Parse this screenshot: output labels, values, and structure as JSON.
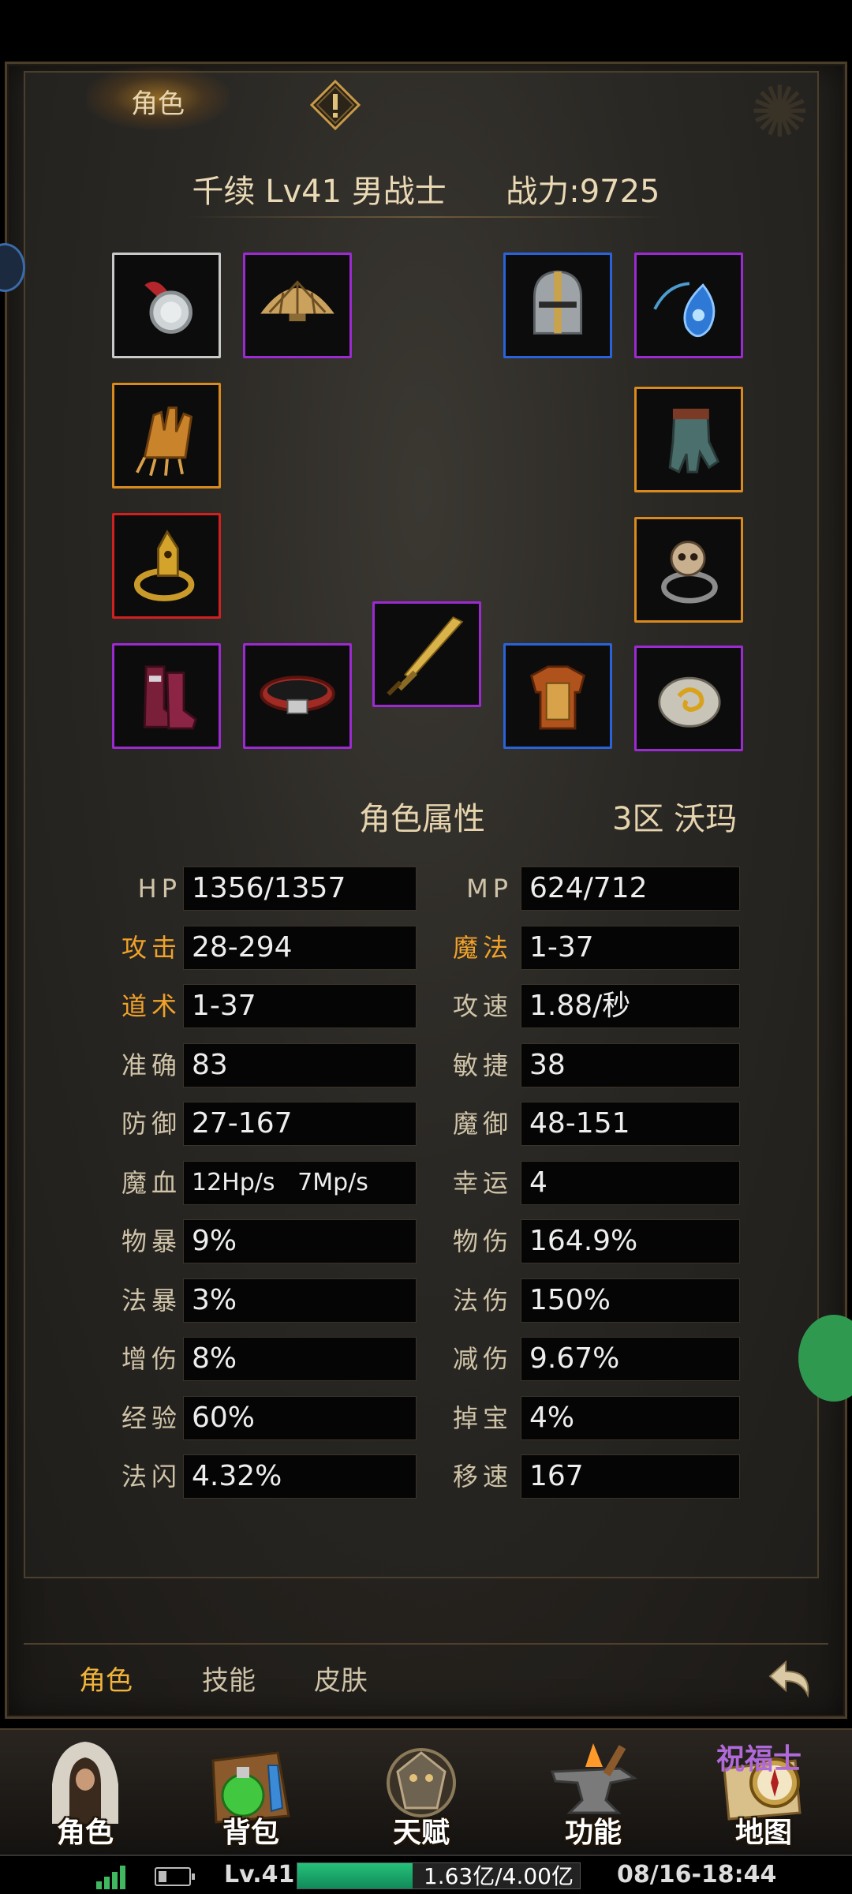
{
  "window": {
    "top_tab": "角色",
    "title": {
      "name": "千续",
      "level": "Lv41",
      "class": "男战士",
      "power": "战力:9725"
    }
  },
  "equipment": [
    {
      "slot": "necklace",
      "quality": "white",
      "icon": "amulet-icon"
    },
    {
      "slot": "shoulder",
      "quality": "purple",
      "icon": "fan-icon"
    },
    {
      "slot": "helmet",
      "quality": "blue",
      "icon": "helmet-icon"
    },
    {
      "slot": "gem",
      "quality": "purple",
      "icon": "gem-pendant-icon"
    },
    {
      "slot": "bracelet-left",
      "quality": "orange",
      "icon": "claw-glove-icon"
    },
    {
      "slot": "bracelet-right",
      "quality": "orange",
      "icon": "glove-icon"
    },
    {
      "slot": "ring-left",
      "quality": "red",
      "icon": "dragon-ring-icon"
    },
    {
      "slot": "ring-right",
      "quality": "orange",
      "icon": "skull-ring-icon"
    },
    {
      "slot": "boots",
      "quality": "purple",
      "icon": "boots-icon"
    },
    {
      "slot": "belt",
      "quality": "purple",
      "icon": "belt-icon"
    },
    {
      "slot": "weapon",
      "quality": "purple",
      "icon": "sword-icon"
    },
    {
      "slot": "armor",
      "quality": "blue",
      "icon": "armor-icon"
    },
    {
      "slot": "charm",
      "quality": "purple",
      "icon": "stone-icon"
    }
  ],
  "attributes": {
    "heading": "角色属性",
    "server": "3区 沃玛",
    "left": [
      {
        "label": "HP",
        "value": "1356/1357",
        "highlight": false
      },
      {
        "label": "攻击",
        "value": "28-294",
        "highlight": true
      },
      {
        "label": "道术",
        "value": "1-37",
        "highlight": true
      },
      {
        "label": "准确",
        "value": "83",
        "highlight": false
      },
      {
        "label": "防御",
        "value": "27-167",
        "highlight": false
      },
      {
        "label": "魔血",
        "value": "12Hp/s   7Mp/s",
        "highlight": false
      },
      {
        "label": "物暴",
        "value": "9%",
        "highlight": false
      },
      {
        "label": "法暴",
        "value": "3%",
        "highlight": false
      },
      {
        "label": "增伤",
        "value": "8%",
        "highlight": false
      },
      {
        "label": "经验",
        "value": "60%",
        "highlight": false
      },
      {
        "label": "法闪",
        "value": "4.32%",
        "highlight": false
      }
    ],
    "right": [
      {
        "label": "MP",
        "value": "624/712",
        "highlight": false
      },
      {
        "label": "魔法",
        "value": "1-37",
        "highlight": true
      },
      {
        "label": "攻速",
        "value": "1.88/秒",
        "highlight": false
      },
      {
        "label": "敏捷",
        "value": "38",
        "highlight": false
      },
      {
        "label": "魔御",
        "value": "48-151",
        "highlight": false
      },
      {
        "label": "幸运",
        "value": "4",
        "highlight": false
      },
      {
        "label": "物伤",
        "value": "164.9%",
        "highlight": false
      },
      {
        "label": "法伤",
        "value": "150%",
        "highlight": false
      },
      {
        "label": "减伤",
        "value": "9.67%",
        "highlight": false
      },
      {
        "label": "掉宝",
        "value": "4%",
        "highlight": false
      },
      {
        "label": "移速",
        "value": "167",
        "highlight": false
      }
    ]
  },
  "tabs": [
    {
      "label": "角色",
      "active": true
    },
    {
      "label": "技能",
      "active": false
    },
    {
      "label": "皮肤",
      "active": false
    }
  ],
  "nav": [
    {
      "label": "角色",
      "icon": "hooded-character-icon"
    },
    {
      "label": "背包",
      "icon": "potion-bag-icon"
    },
    {
      "label": "天赋",
      "icon": "dragon-emblem-icon"
    },
    {
      "label": "功能",
      "icon": "anvil-icon"
    },
    {
      "label": "地图",
      "icon": "compass-map-icon"
    }
  ],
  "nav_overlay": "祝福士",
  "status": {
    "level": "Lv.41",
    "exp_text": "1.63亿/4.00亿",
    "exp_fraction": 0.4075,
    "datetime": "08/16-18:44"
  },
  "colors": {
    "accent": "#f0a22a",
    "quality_white": "#c9c9c9",
    "quality_purple": "#9c2ad1",
    "quality_blue": "#2a63d9",
    "quality_orange": "#d98a1c",
    "quality_red": "#d12020",
    "exp_bar": "#1fb56c"
  }
}
